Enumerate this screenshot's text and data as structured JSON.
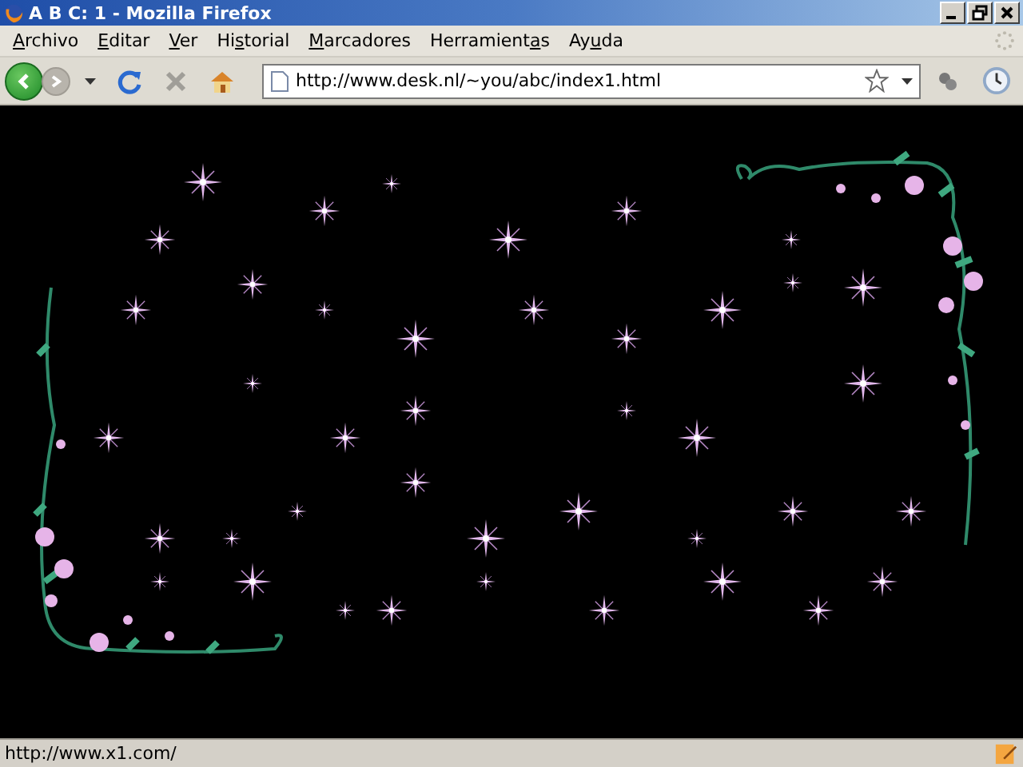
{
  "window": {
    "title": "A B C: 1 - Mozilla Firefox"
  },
  "menu": [
    {
      "label": "Archivo"
    },
    {
      "label": "Editar"
    },
    {
      "label": "Ver"
    },
    {
      "label": "Historial"
    },
    {
      "label": "Marcadores"
    },
    {
      "label": "Herramientas"
    },
    {
      "label": "Ayuda"
    }
  ],
  "toolbar": {
    "address": "http://www.desk.nl/~you/abc/index1.html"
  },
  "status_bar": {
    "text": "http://www.x1.com/"
  }
}
